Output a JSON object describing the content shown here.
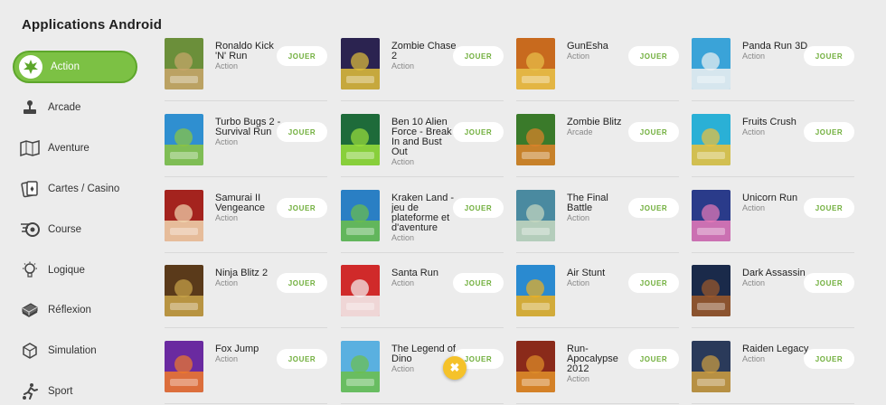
{
  "page_title": "Applications Android",
  "categories": [
    {
      "label": "Action",
      "icon": "action-burst-icon",
      "active": true
    },
    {
      "label": "Arcade",
      "icon": "joystick-icon",
      "active": false
    },
    {
      "label": "Aventure",
      "icon": "map-icon",
      "active": false
    },
    {
      "label": "Cartes / Casino",
      "icon": "cards-icon",
      "active": false
    },
    {
      "label": "Course",
      "icon": "racing-wheel-icon",
      "active": false
    },
    {
      "label": "Logique",
      "icon": "lightbulb-icon",
      "active": false
    },
    {
      "label": "Réflexion",
      "icon": "brain-blocks-icon",
      "active": false
    },
    {
      "label": "Simulation",
      "icon": "cube-icon",
      "active": false
    },
    {
      "label": "Sport",
      "icon": "runner-icon",
      "active": false
    }
  ],
  "play_label": "JOUER",
  "accent_color": "#7cc144",
  "fab_icon": "close-icon",
  "games": [
    [
      {
        "name": "Ronaldo Kick 'N' Run",
        "genre": "Action",
        "c1": "#6b8f3a",
        "c2": "#c9a66b"
      },
      {
        "name": "Zombie Chase 2",
        "genre": "Action",
        "c1": "#2b2350",
        "c2": "#e2c03a"
      },
      {
        "name": "GunEsha",
        "genre": "Action",
        "c1": "#c86a1e",
        "c2": "#e8c24a"
      },
      {
        "name": "Panda Run 3D",
        "genre": "Action",
        "c1": "#3aa3d8",
        "c2": "#f2f2f2"
      }
    ],
    [
      {
        "name": "Turbo Bugs 2 - Survival Run",
        "genre": "Action",
        "c1": "#2f8fd0",
        "c2": "#8dc63f"
      },
      {
        "name": "Ben 10 Alien Force - Break In and Bust Out",
        "genre": "Action",
        "c1": "#1e6b3a",
        "c2": "#9be03c"
      },
      {
        "name": "Zombie Blitz",
        "genre": "Arcade",
        "c1": "#3a7a2a",
        "c2": "#e0832a"
      },
      {
        "name": "Fruits Crush",
        "genre": "Action",
        "c1": "#2ab0d6",
        "c2": "#f0c23a"
      }
    ],
    [
      {
        "name": "Samurai II Vengeance",
        "genre": "Action",
        "c1": "#a4231e",
        "c2": "#f2d7b0"
      },
      {
        "name": "Kraken Land - jeu de plateforme et d'aventure",
        "genre": "Action",
        "c1": "#2a7fc4",
        "c2": "#6cbf4a"
      },
      {
        "name": "The Final Battle",
        "genre": "Action",
        "c1": "#4a8aa0",
        "c2": "#c7d8c0"
      },
      {
        "name": "Unicorn Run",
        "genre": "Action",
        "c1": "#2a3b8a",
        "c2": "#e87ab8"
      }
    ],
    [
      {
        "name": "Ninja Blitz 2",
        "genre": "Action",
        "c1": "#5a3a1a",
        "c2": "#c9a44a"
      },
      {
        "name": "Santa Run",
        "genre": "Action",
        "c1": "#d02a2a",
        "c2": "#f5f5f5"
      },
      {
        "name": "Air Stunt",
        "genre": "Action",
        "c1": "#2a8ad0",
        "c2": "#f0b020"
      },
      {
        "name": "Dark Assassin",
        "genre": "Action",
        "c1": "#1a2a4a",
        "c2": "#a05a2a"
      }
    ],
    [
      {
        "name": "Fox Jump",
        "genre": "Action",
        "c1": "#6a2aa0",
        "c2": "#f07a2a"
      },
      {
        "name": "The Legend of Dino",
        "genre": "Action",
        "c1": "#5ab0e0",
        "c2": "#6cc04a"
      },
      {
        "name": "Run-Apocalypse 2012",
        "genre": "Action",
        "c1": "#8a2a1a",
        "c2": "#e0902a"
      },
      {
        "name": "Raiden Legacy",
        "genre": "Action",
        "c1": "#2a3a5a",
        "c2": "#d0a040"
      }
    ]
  ]
}
